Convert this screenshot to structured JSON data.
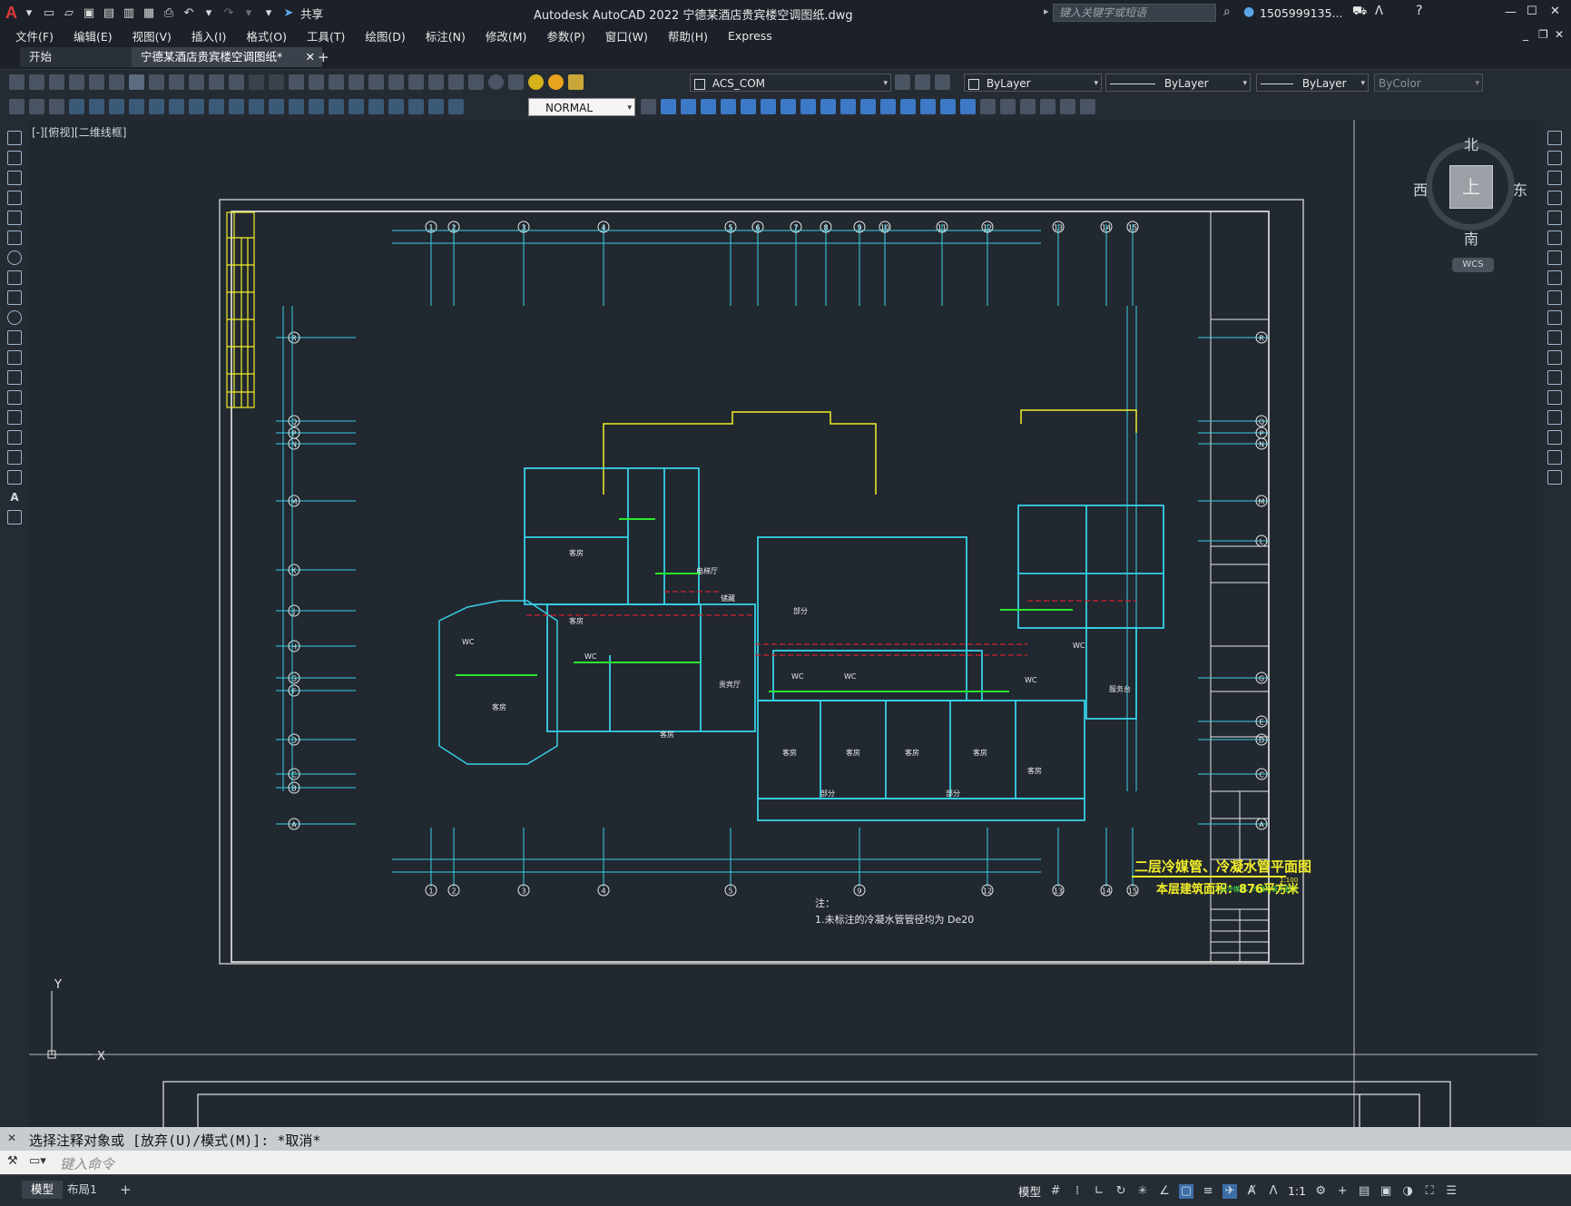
{
  "app": {
    "title": "Autodesk AutoCAD 2022    宁德某酒店贵宾楼空调图纸.dwg",
    "logo": "A",
    "share": "共享",
    "search_placeholder": "键入关键字或短语",
    "user": "1505999135...",
    "window_controls": [
      "—",
      "☐",
      "✕"
    ]
  },
  "menu": [
    "文件(F)",
    "编辑(E)",
    "视图(V)",
    "插入(I)",
    "格式(O)",
    "工具(T)",
    "绘图(D)",
    "标注(N)",
    "修改(M)",
    "参数(P)",
    "窗口(W)",
    "帮助(H)",
    "Express"
  ],
  "tabs": {
    "start": "开始",
    "active": "宁德某酒店贵宾楼空调图纸*",
    "close": "✕",
    "add": "+"
  },
  "toolbar": {
    "layer": "ACS_COM",
    "color": "ByLayer",
    "linetype": "ByLayer",
    "lineweight": "ByLayer",
    "plotstyle": "ByColor",
    "dimstyle": "NORMAL"
  },
  "viewport": {
    "label": "[-][俯视][二维线框]",
    "compass": {
      "n": "北",
      "s": "南",
      "e": "东",
      "w": "西",
      "top": "上",
      "wcs": "WCS"
    },
    "ucs_y": "Y",
    "ucs_x": "X"
  },
  "drawing": {
    "grid_top": [
      "1",
      "2",
      "3",
      "4",
      "5",
      "6",
      "7",
      "8",
      "9",
      "10",
      "11",
      "12",
      "13",
      "14",
      "15"
    ],
    "grid_bottom": [
      "1",
      "2",
      "3",
      "4",
      "5",
      "9",
      "12",
      "13",
      "14",
      "15"
    ],
    "grid_left": [
      "R",
      "Q",
      "P",
      "N",
      "M",
      "K",
      "J",
      "H",
      "G",
      "F",
      "D",
      "C",
      "B",
      "A"
    ],
    "grid_right": [
      "R",
      "Q",
      "P",
      "N",
      "M",
      "L",
      "G",
      "E",
      "D",
      "C",
      "A"
    ],
    "title_main": "二层冷媒管、冷凝水管平面图",
    "title_scale": "1:100",
    "area_text": "本层建筑面积：876平方米",
    "note_title": "注：",
    "note_text": "1.未标注的冷凝水管管径均为 De20",
    "titleblock_name": "二层冷媒管、冷凝水管平面图",
    "rooms": [
      "客房",
      "客房",
      "客房",
      "客房",
      "客房",
      "客房",
      "客房",
      "客房",
      "客房",
      "电梯厅",
      "储藏",
      "部分",
      "WC",
      "WC",
      "WC",
      "WC",
      "WC",
      "WC",
      "贵宾厅",
      "服务台",
      "部分",
      "部分"
    ]
  },
  "command": {
    "history": "选择注释对象或 [放弃(U)/模式(M)]: *取消*",
    "placeholder": "键入命令"
  },
  "status": {
    "tab_model": "模型",
    "tab_layout": "布局1",
    "add": "+",
    "model_label": "模型",
    "scale": "1:1"
  }
}
